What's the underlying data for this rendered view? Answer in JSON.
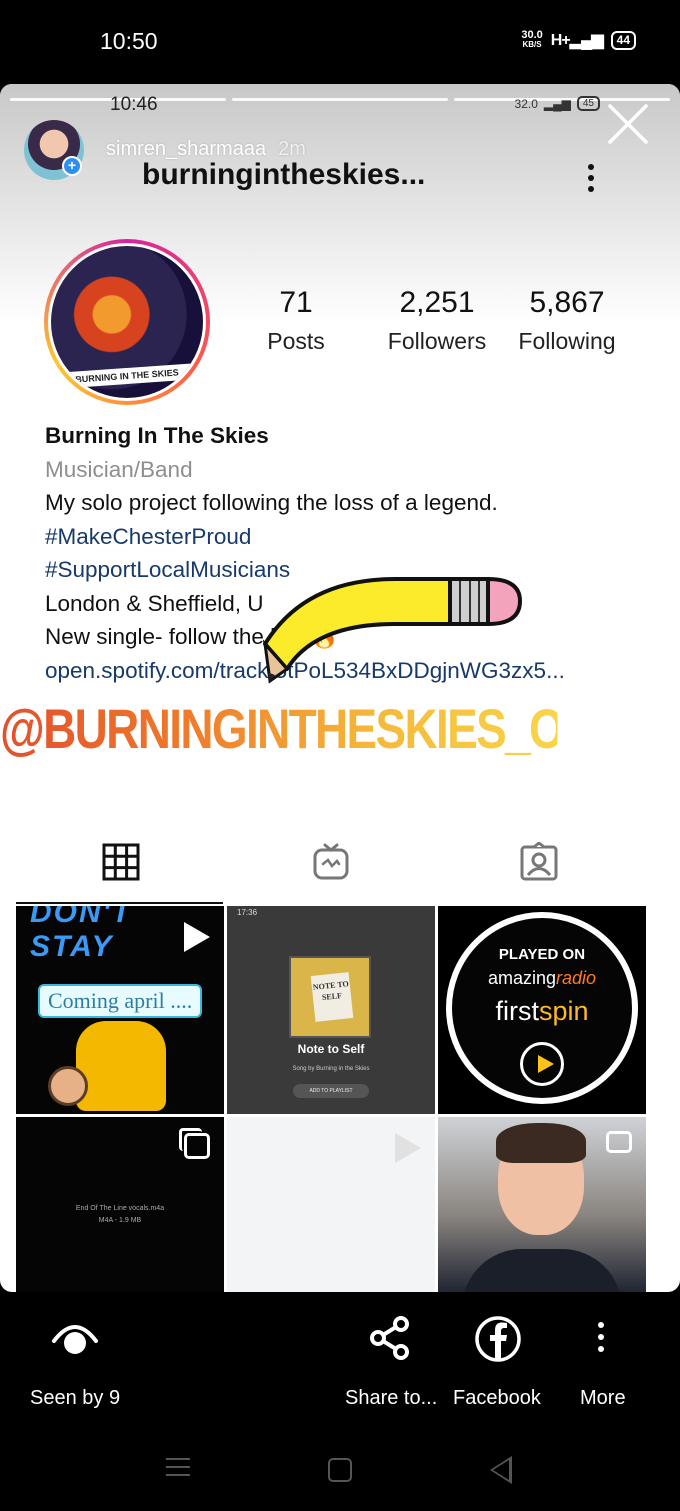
{
  "status_bar": {
    "time": "10:50",
    "speed_value": "30.0",
    "speed_unit": "KB/S",
    "network": "H+",
    "battery": "44"
  },
  "story": {
    "inner_time": "10:46",
    "inner_speed": "32.0",
    "inner_battery": "45",
    "user": "simren_sharmaaa",
    "posted_ago": "2m"
  },
  "profile": {
    "username": "burningintheskies...",
    "band_text": "BURNING IN THE SKIES",
    "stats": [
      {
        "value": "71",
        "label": "Posts"
      },
      {
        "value": "2,251",
        "label": "Followers"
      },
      {
        "value": "5,867",
        "label": "Following"
      }
    ],
    "name": "Burning In The Skies",
    "category": "Musician/Band",
    "bio_line": "My solo project following the loss of a legend.",
    "hashtag1": "#MakeChesterProud",
    "hashtag2": "#SupportLocalMusicians",
    "location": "London & Sheffield, U",
    "single_line": "New single- follow the link 🔥",
    "link": "open.spotify.com/track/5tPoL534BxDDgjnWG3zx5..."
  },
  "overlay_handle": "@BURNINGINTHESKIES_OFFICIAL",
  "posts": {
    "post1_heading": "DON'T STAY",
    "post1_caption": "Coming april ....",
    "post2_time": "17:36",
    "post2_cover": "NOTE TO SELF",
    "post2_title": "Note to Self",
    "post2_sub": "Song by Burning in the Skies",
    "post2_button": "ADD TO PLAYLIST",
    "post3_played": "PLAYED ON",
    "post3_amazing_a": "amazing",
    "post3_amazing_b": "radio",
    "post3_first_a": "first",
    "post3_first_b": "spin",
    "post4_file": "End Of The Line vocals.m4a",
    "post4_size": "M4A - 1.9 MB"
  },
  "footer": {
    "seen_label": "Seen by 9",
    "share_label": "Share to...",
    "facebook_label": "Facebook",
    "more_label": "More"
  },
  "colors": {
    "link": "#173a6a",
    "handle_gradient_start": "#e24f2d",
    "handle_gradient_end": "#f8d54a"
  }
}
